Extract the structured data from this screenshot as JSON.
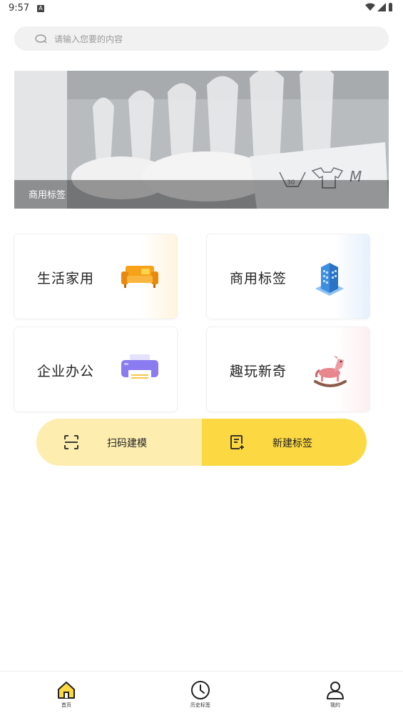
{
  "status_bar": {
    "time": "9:57",
    "notification_badge": "A"
  },
  "search": {
    "placeholder": "请输入您要的内容"
  },
  "banner": {
    "caption": "商用标签"
  },
  "categories": [
    {
      "label": "生活家用",
      "icon": "sofa-icon",
      "accent": "#f7a21b"
    },
    {
      "label": "商用标签",
      "icon": "building-icon",
      "accent": "#3d8fe0"
    },
    {
      "label": "企业办公",
      "icon": "printer-icon",
      "accent": "#8a7cf0"
    },
    {
      "label": "趣玩新奇",
      "icon": "rocking-horse-icon",
      "accent": "#e8868e"
    }
  ],
  "actions": {
    "scan": {
      "label": "扫码建模",
      "icon": "scan-icon"
    },
    "new_label": {
      "label": "新建标签",
      "icon": "new-document-icon"
    }
  },
  "bottom_nav": [
    {
      "label": "首页",
      "icon": "home-icon",
      "active": true
    },
    {
      "label": "历史标签",
      "icon": "clock-icon",
      "active": false
    },
    {
      "label": "我的",
      "icon": "user-icon",
      "active": false
    }
  ],
  "colors": {
    "accent_yellow": "#fcd843",
    "light_yellow": "#fdeeb0"
  }
}
